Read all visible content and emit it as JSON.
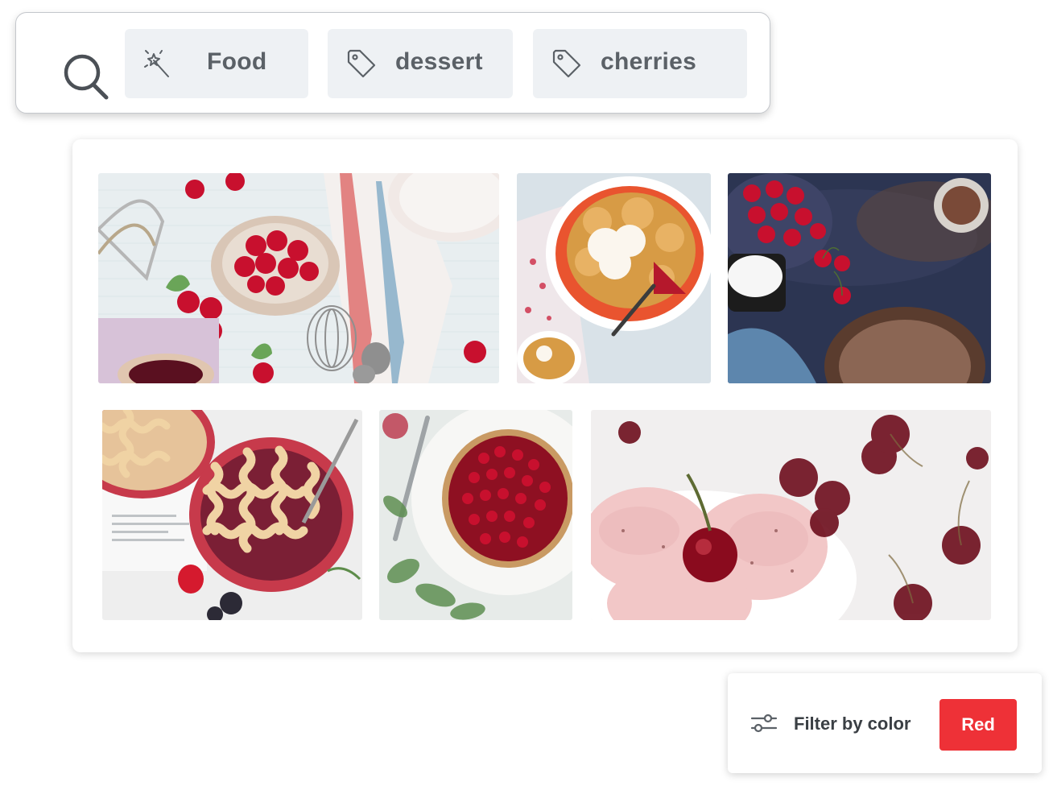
{
  "search": {
    "chips": [
      {
        "label": "Food",
        "icon": "magic-wand-icon"
      },
      {
        "label": "dessert",
        "icon": "tag-icon"
      },
      {
        "label": "cherries",
        "icon": "tag-icon"
      }
    ]
  },
  "gallery": {
    "photos": [
      {
        "name": "photo-cherries-bowl-baking"
      },
      {
        "name": "photo-cobbler-ice-cream"
      },
      {
        "name": "photo-cherries-dark-table"
      },
      {
        "name": "photo-lattice-pies"
      },
      {
        "name": "photo-cranberry-tart"
      },
      {
        "name": "photo-cherry-ice-cream"
      }
    ]
  },
  "filter": {
    "label": "Filter by color",
    "value": "Red",
    "accent": "#ee3137"
  }
}
